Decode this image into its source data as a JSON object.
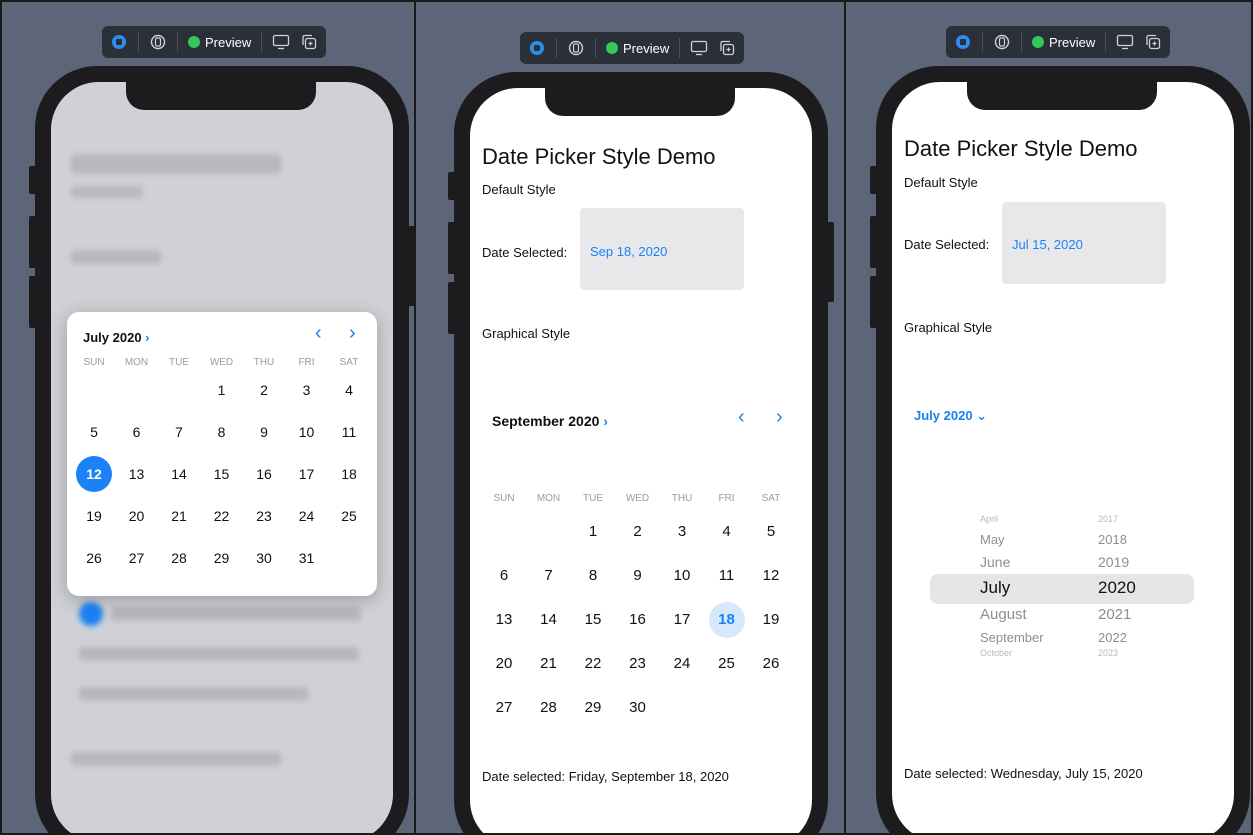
{
  "toolbar": {
    "preview_label": "Preview"
  },
  "panels": {
    "left": {
      "popover": {
        "month_label": "July 2020",
        "weekdays": [
          "SUN",
          "MON",
          "TUE",
          "WED",
          "THU",
          "FRI",
          "SAT"
        ],
        "selected_day": "12",
        "weeks": [
          [
            "",
            "",
            "",
            "1",
            "2",
            "3",
            "4"
          ],
          [
            "5",
            "6",
            "7",
            "8",
            "9",
            "10",
            "11"
          ],
          [
            "12",
            "13",
            "14",
            "15",
            "16",
            "17",
            "18"
          ],
          [
            "19",
            "20",
            "21",
            "22",
            "23",
            "24",
            "25"
          ],
          [
            "26",
            "27",
            "28",
            "29",
            "30",
            "31",
            ""
          ]
        ]
      }
    },
    "middle": {
      "title": "Date Picker Style Demo",
      "default_style_label": "Default Style",
      "date_selected_label": "Date Selected:",
      "date_selected_value": "Sep 18, 2020",
      "graphical_style_label": "Graphical Style",
      "calendar": {
        "month_label": "September 2020",
        "weekdays": [
          "SUN",
          "MON",
          "TUE",
          "WED",
          "THU",
          "FRI",
          "SAT"
        ],
        "selected_day": "18",
        "weeks": [
          [
            "",
            "",
            "1",
            "2",
            "3",
            "4",
            "5"
          ],
          [
            "6",
            "7",
            "8",
            "9",
            "10",
            "11",
            "12"
          ],
          [
            "13",
            "14",
            "15",
            "16",
            "17",
            "18",
            "19"
          ],
          [
            "20",
            "21",
            "22",
            "23",
            "24",
            "25",
            "26"
          ],
          [
            "27",
            "28",
            "29",
            "30",
            "",
            "",
            ""
          ]
        ]
      },
      "footer": "Date selected: Friday, September 18, 2020"
    },
    "right": {
      "title": "Date Picker Style Demo",
      "default_style_label": "Default Style",
      "date_selected_label": "Date Selected:",
      "date_selected_value": "Jul 15, 2020",
      "graphical_style_label": "Graphical Style",
      "month_dropdown": "July 2020",
      "months": [
        "April",
        "May",
        "June",
        "July",
        "August",
        "September",
        "October"
      ],
      "years": [
        "2017",
        "2018",
        "2019",
        "2020",
        "2021",
        "2022",
        "2023"
      ],
      "selected_month": "July",
      "selected_year": "2020",
      "footer": "Date selected: Wednesday, July 15, 2020"
    }
  },
  "colors": {
    "accent": "#1a82f5",
    "canvas": "#5d6578",
    "phone": "#1c1c1e"
  }
}
